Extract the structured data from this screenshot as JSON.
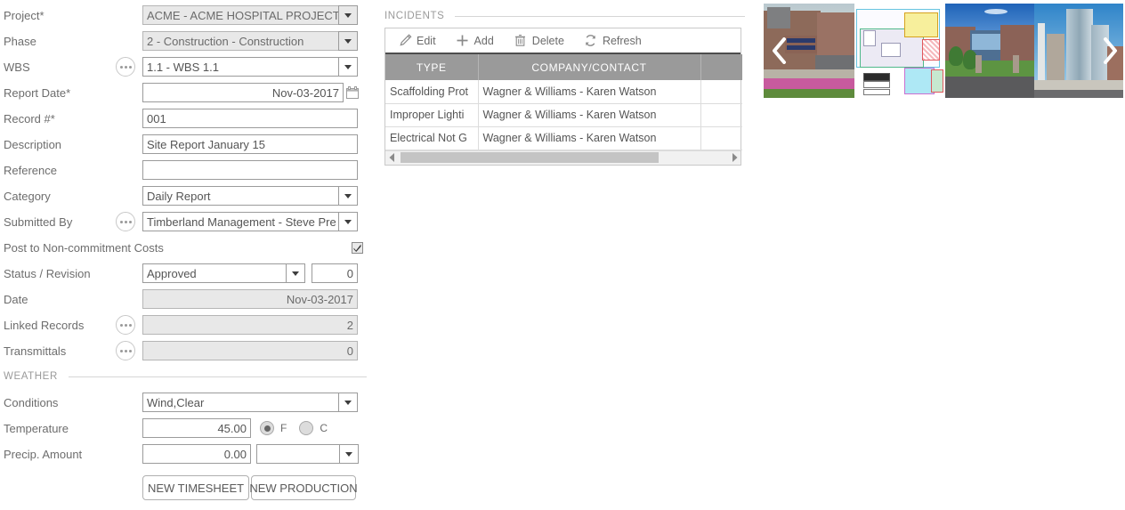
{
  "form": {
    "fields": [
      {
        "label": "Project*",
        "value": "ACME - ACME HOSPITAL PROJECT",
        "type": "combo",
        "state": "grey"
      },
      {
        "label": "Phase",
        "value": "2 - Construction - Construction",
        "type": "combo",
        "state": "grey"
      },
      {
        "label": "WBS",
        "value": "1.1 - WBS 1.1",
        "type": "combo",
        "state": "white"
      },
      {
        "label": "Report Date*",
        "value": "Nov-03-2017",
        "type": "date",
        "state": "white"
      },
      {
        "label": "Record #*",
        "value": "001",
        "type": "text",
        "state": "white"
      },
      {
        "label": "Description",
        "value": "Site Report January 15",
        "type": "text",
        "state": "white"
      },
      {
        "label": "Reference",
        "value": "",
        "type": "text",
        "state": "white"
      },
      {
        "label": "Category",
        "value": "Daily Report",
        "type": "combo",
        "state": "white"
      },
      {
        "label": "Submitted By",
        "value": "Timberland Management - Steve Pre",
        "type": "combo",
        "state": "white"
      }
    ],
    "post_to_non_commitment": {
      "label": "Post to Non-commitment Costs",
      "checked": true
    },
    "status": {
      "label": "Status / Revision",
      "value": "Approved",
      "revision": "0"
    },
    "date": {
      "label": "Date",
      "value": "Nov-03-2017"
    },
    "linked_records": {
      "label": "Linked Records",
      "value": "2"
    },
    "transmittals": {
      "label": "Transmittals",
      "value": "0"
    }
  },
  "weather": {
    "section_title": "WEATHER",
    "conditions": {
      "label": "Conditions",
      "value": "Wind,Clear"
    },
    "temperature": {
      "label": "Temperature",
      "value": "45.00",
      "unit_f": "F",
      "unit_c": "C",
      "selected_unit": "F"
    },
    "precip": {
      "label": "Precip. Amount",
      "value": "0.00",
      "unit": ""
    }
  },
  "actions": {
    "new_timesheet": "NEW TIMESHEET",
    "new_production": "NEW PRODUCTION"
  },
  "incidents": {
    "section_title": "INCIDENTS",
    "toolbar": [
      {
        "label": "Edit",
        "icon": "pencil-icon"
      },
      {
        "label": "Add",
        "icon": "plus-icon"
      },
      {
        "label": "Delete",
        "icon": "trash-icon"
      },
      {
        "label": "Refresh",
        "icon": "refresh-icon"
      }
    ],
    "columns": [
      "TYPE",
      "COMPANY/CONTACT",
      ""
    ],
    "rows": [
      {
        "type": "Scaffolding Prot",
        "company": "Wagner & Williams - Karen Watson",
        "extra": ""
      },
      {
        "type": "Improper Lighti",
        "company": "Wagner & Williams - Karen Watson",
        "extra": ""
      },
      {
        "type": "Electrical Not G",
        "company": "Wagner & Williams - Karen Watson",
        "extra": ""
      }
    ]
  },
  "carousel": {
    "prev_label": "‹",
    "next_label": "›",
    "slides": [
      {
        "name": "boston-medical-photo"
      },
      {
        "name": "floor-plan-drawing"
      },
      {
        "name": "campus-building-photo"
      },
      {
        "name": "highrise-tower-photo"
      }
    ]
  },
  "colors": {
    "header_grey": "#9a9a9a",
    "label_grey": "#6d6d6d",
    "field_border": "#9b9b9b",
    "disabled_bg": "#e8e8e8"
  }
}
